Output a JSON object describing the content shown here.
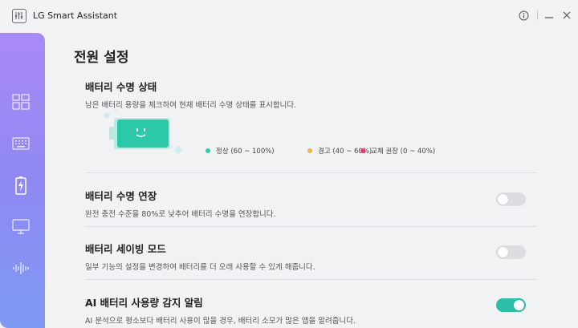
{
  "app": {
    "title": "LG Smart Assistant"
  },
  "page": {
    "title": "전원 설정"
  },
  "sidebar": {
    "items": [
      {
        "name": "dashboard",
        "icon": "grid-icon"
      },
      {
        "name": "keyboard",
        "icon": "keyboard-icon"
      },
      {
        "name": "power",
        "icon": "battery-icon",
        "active": true
      },
      {
        "name": "display",
        "icon": "monitor-icon"
      },
      {
        "name": "sound",
        "icon": "sound-wave-icon"
      }
    ]
  },
  "battery_status": {
    "title": "배터리 수명 상태",
    "desc": "남은 배터리 용량을 체크하여 현재 배터리 수명 상태를 표시합니다.",
    "legend": [
      {
        "label": "정상 (60 ~ 100%)",
        "color": "#2cc9a8"
      },
      {
        "label": "경고 (40 ~ 60%)",
        "color": "#f0b34a"
      },
      {
        "label": "교체 권장 (0 ~ 40%)",
        "color": "#ef3a6b"
      }
    ]
  },
  "settings": [
    {
      "title": "배터리 수명 연장",
      "desc": "완전 충전 수준을 80%로 낮추어 배터리 수명을 연장합니다.",
      "on": false
    },
    {
      "title": "배터리 세이빙 모드",
      "desc": "일부 기능의 설정을 변경하여 배터리를 더 오래 사용할 수 있게 해줍니다.",
      "on": false
    },
    {
      "title": "AI 배터리 사용량 감지 알림",
      "desc": "AI 분석으로 평소보다 배터리 사용이 많을 경우, 배터리 소모가 많은 앱을 알려줍니다.",
      "on": true
    }
  ],
  "colors": {
    "accent": "#2bbfa7",
    "sidebar_top": "#a98af5",
    "sidebar_bottom": "#7f9af2"
  }
}
